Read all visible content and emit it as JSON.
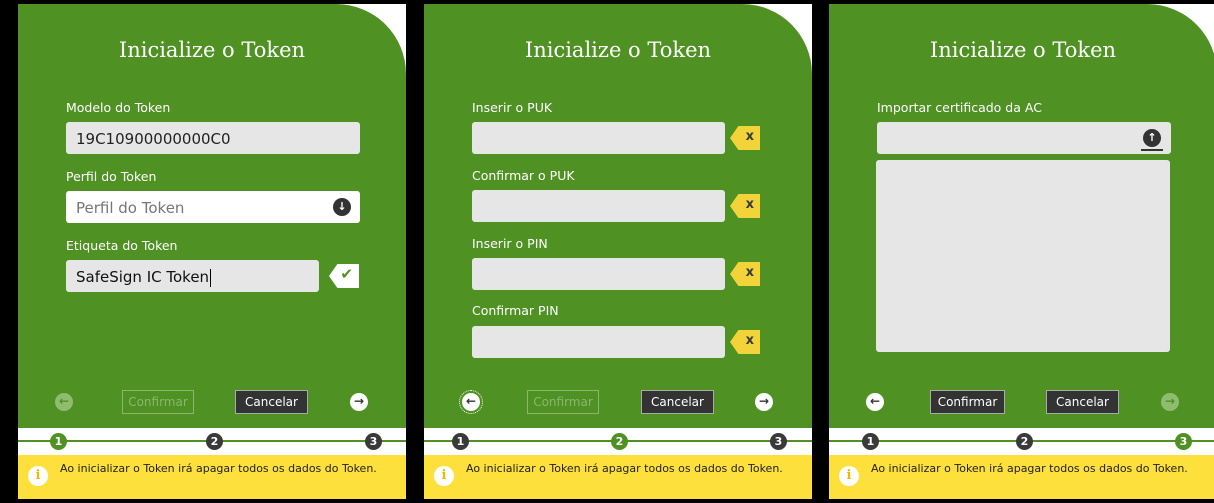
{
  "panels": [
    {
      "title": "Inicialize o Token",
      "fields": {
        "model_label": "Modelo do Token",
        "model_value": "19C10900000000C0",
        "profile_label": "Perfil do Token",
        "profile_placeholder": "Perfil do Token",
        "tag_label": "Etiqueta do Token",
        "tag_value": "SafeSign IC Token"
      },
      "buttons": {
        "confirm": "Confirmar",
        "cancel": "Cancelar"
      },
      "current_step": 1
    },
    {
      "title": "Inicialize o Token",
      "fields": {
        "puk_label": "Inserir o PUK",
        "puk_confirm_label": "Confirmar o PUK",
        "pin_label": "Inserir o PIN",
        "pin_confirm_label": "Confirmar PIN"
      },
      "buttons": {
        "confirm": "Confirmar",
        "cancel": "Cancelar"
      },
      "current_step": 2
    },
    {
      "title": "Inicialize o Token",
      "fields": {
        "import_label": "Importar certificado da AC"
      },
      "buttons": {
        "confirm": "Confirmar",
        "cancel": "Cancelar"
      },
      "current_step": 3
    }
  ],
  "steps": [
    "1",
    "2",
    "3"
  ],
  "icons": {
    "back": "←",
    "forward": "→",
    "dropdown": "↓",
    "upload": "↑",
    "check": "✔",
    "clear": "x",
    "info": "i"
  },
  "warning": "Ao inicializar o Token irá apagar todos os dados do Token.",
  "colors": {
    "panel_green": "#4f9123",
    "warning_yellow": "#fde03c",
    "tag_yellow": "#f2d33a",
    "field_gray": "#e6e6e6"
  }
}
